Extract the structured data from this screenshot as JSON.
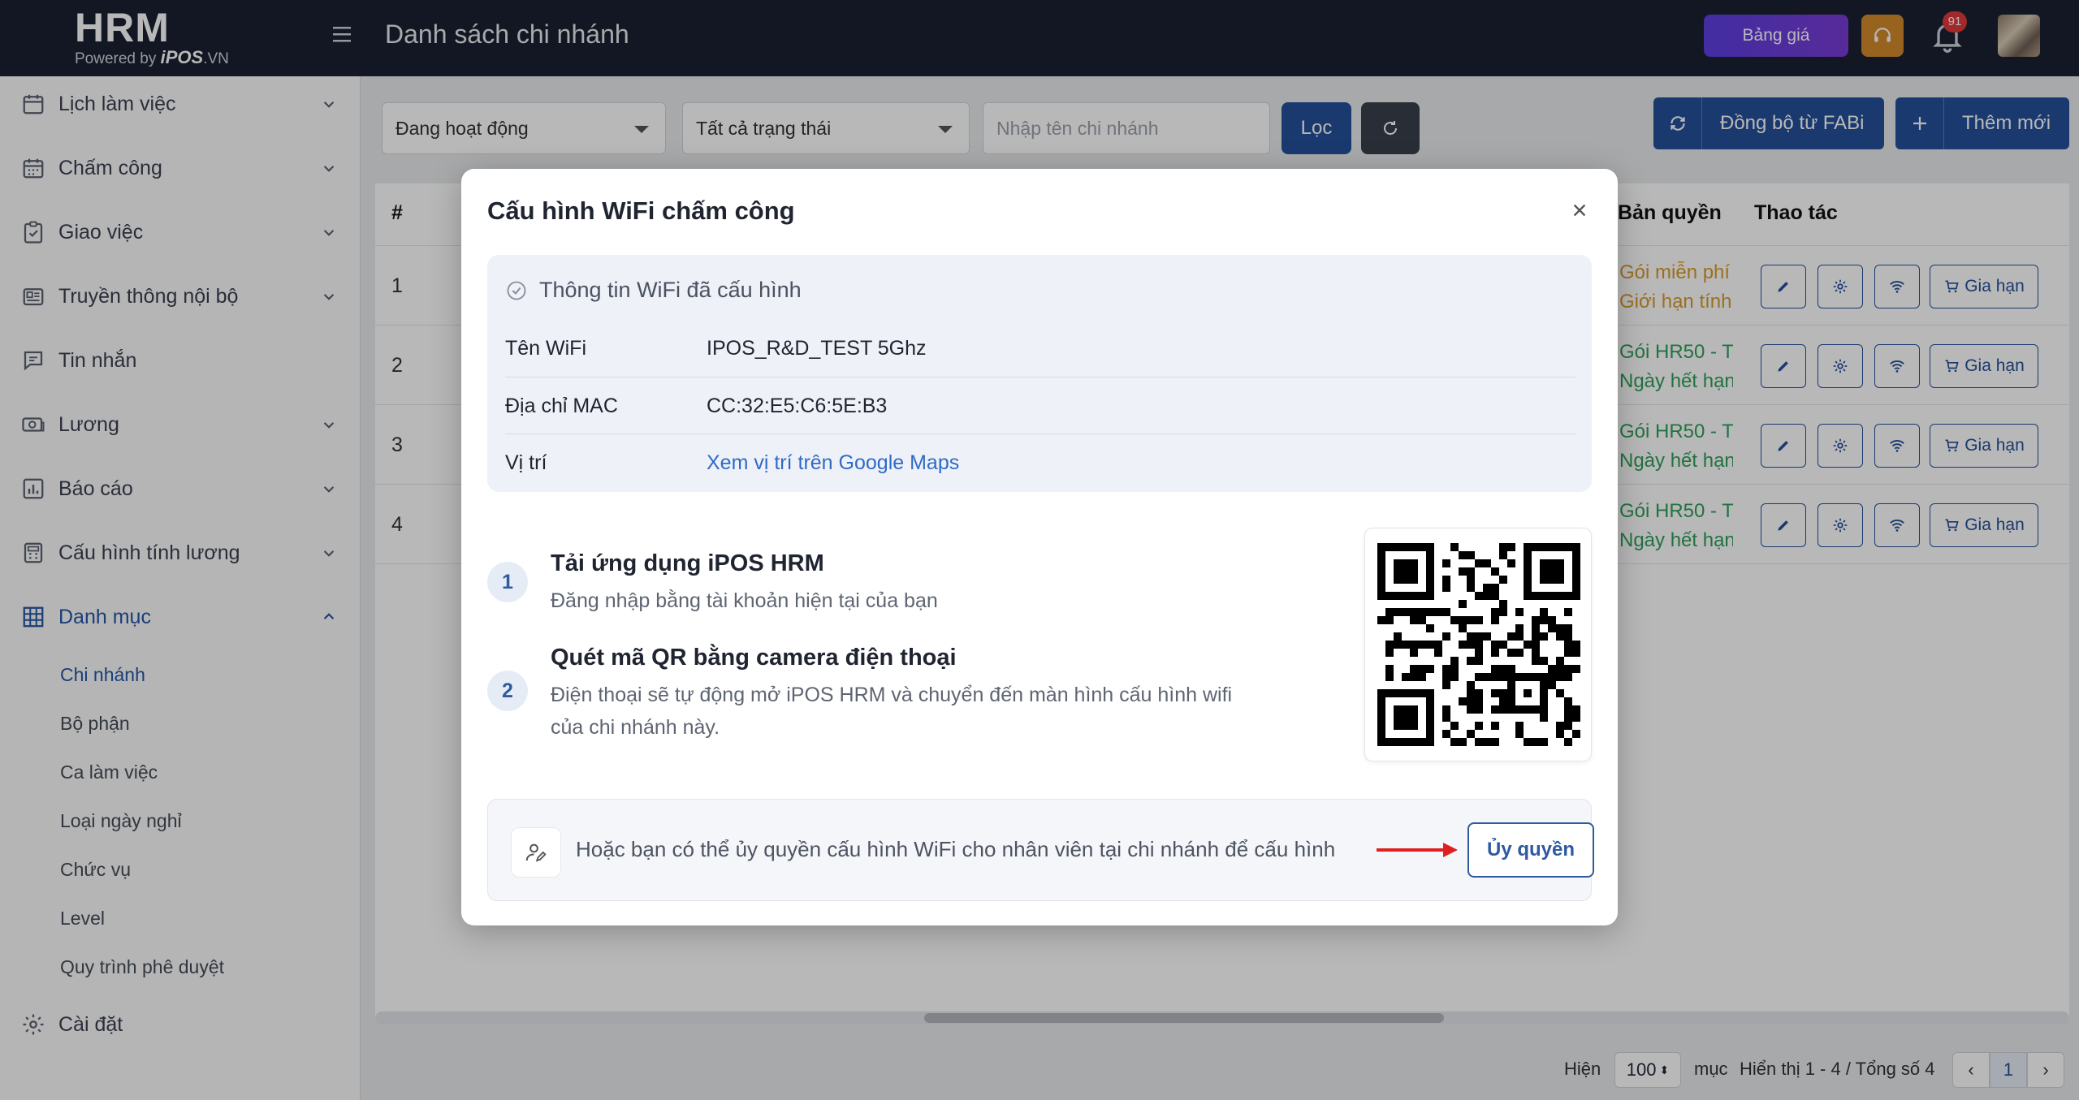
{
  "header": {
    "logo_main": "HRM",
    "logo_powered": "Powered by",
    "logo_brand": "iPOS",
    "logo_domain": ".VN",
    "page_title": "Danh sách chi nhánh",
    "pricing_label": "Bảng giá",
    "notification_count": "91"
  },
  "sidebar": {
    "items": [
      {
        "label": "Lịch làm việc",
        "icon": "calendar-icon"
      },
      {
        "label": "Chấm công",
        "icon": "calendar-grid-icon"
      },
      {
        "label": "Giao việc",
        "icon": "clipboard-check-icon"
      },
      {
        "label": "Truyền thông nội bộ",
        "icon": "newspaper-icon"
      },
      {
        "label": "Tin nhắn",
        "icon": "message-icon"
      },
      {
        "label": "Lương",
        "icon": "money-icon"
      },
      {
        "label": "Báo cáo",
        "icon": "chart-icon"
      },
      {
        "label": "Cấu hình tính lương",
        "icon": "calculator-icon"
      },
      {
        "label": "Danh mục",
        "icon": "grid-icon"
      }
    ],
    "sub_items": [
      "Chi nhánh",
      "Bộ phận",
      "Ca làm việc",
      "Loại ngày nghỉ",
      "Chức vụ",
      "Level",
      "Quy trình phê duyệt"
    ],
    "settings_label": "Cài đặt"
  },
  "filters": {
    "status_select": "Đang hoạt động",
    "all_status_select": "Tất cả trạng thái",
    "search_placeholder": "Nhập tên chi nhánh",
    "filter_button": "Lọc",
    "sync_button": "Đồng bộ từ FABi",
    "add_button": "Thêm mới"
  },
  "table": {
    "columns": {
      "index": "#",
      "license": "Bản quyền",
      "actions": "Thao tác"
    },
    "rows": [
      {
        "index": "1",
        "license_line1": "Gói miễn phí",
        "license_line2": "Giới hạn tính"
      },
      {
        "index": "2",
        "license_line1": "Gói HR50 - T",
        "license_line2": "Ngày hết hạn"
      },
      {
        "index": "3",
        "license_line1": "Gói HR50 - T",
        "license_line2": "Ngày hết hạn"
      },
      {
        "index": "4",
        "license_line1": "Gói HR50 - T",
        "license_line2": "Ngày hết hạn"
      }
    ],
    "renew_label": "Gia hạn"
  },
  "pagination": {
    "show_label": "Hiện",
    "per_page": "100",
    "items_label": "mục",
    "summary": "Hiển thị 1 - 4 / Tổng số 4",
    "prev": "‹",
    "current_page": "1",
    "next": "›"
  },
  "modal": {
    "title": "Cấu hình WiFi chấm công",
    "info_header": "Thông tin WiFi đã cấu hình",
    "wifi_name_label": "Tên WiFi",
    "wifi_name_value": "IPOS_R&D_TEST 5Ghz",
    "mac_label": "Địa chỉ MAC",
    "mac_value": "CC:32:E5:C6:5E:B3",
    "location_label": "Vị trí",
    "location_link": "Xem vị trí trên Google Maps",
    "step1_num": "1",
    "step1_title": "Tải ứng dụng iPOS HRM",
    "step1_desc": "Đăng nhập bằng tài khoản hiện tại của bạn",
    "step2_num": "2",
    "step2_title": "Quét mã QR bằng camera điện thoại",
    "step2_desc": "Điện thoại sẽ tự động mở iPOS HRM và chuyển đến màn hình cấu hình wifi của chi nhánh này.",
    "delegate_text": "Hoặc bạn có thể ủy quyền cấu hình WiFi cho nhân viên tại chi nhánh để cấu hình",
    "authorize_button": "Ủy quyền"
  },
  "colors": {
    "topbar": "#1a2131",
    "primary": "#24509a",
    "link": "#2f6bc6",
    "license_green": "#2f9e5a",
    "license_orange": "#d89a2a",
    "annotation_arrow": "#e02020"
  }
}
